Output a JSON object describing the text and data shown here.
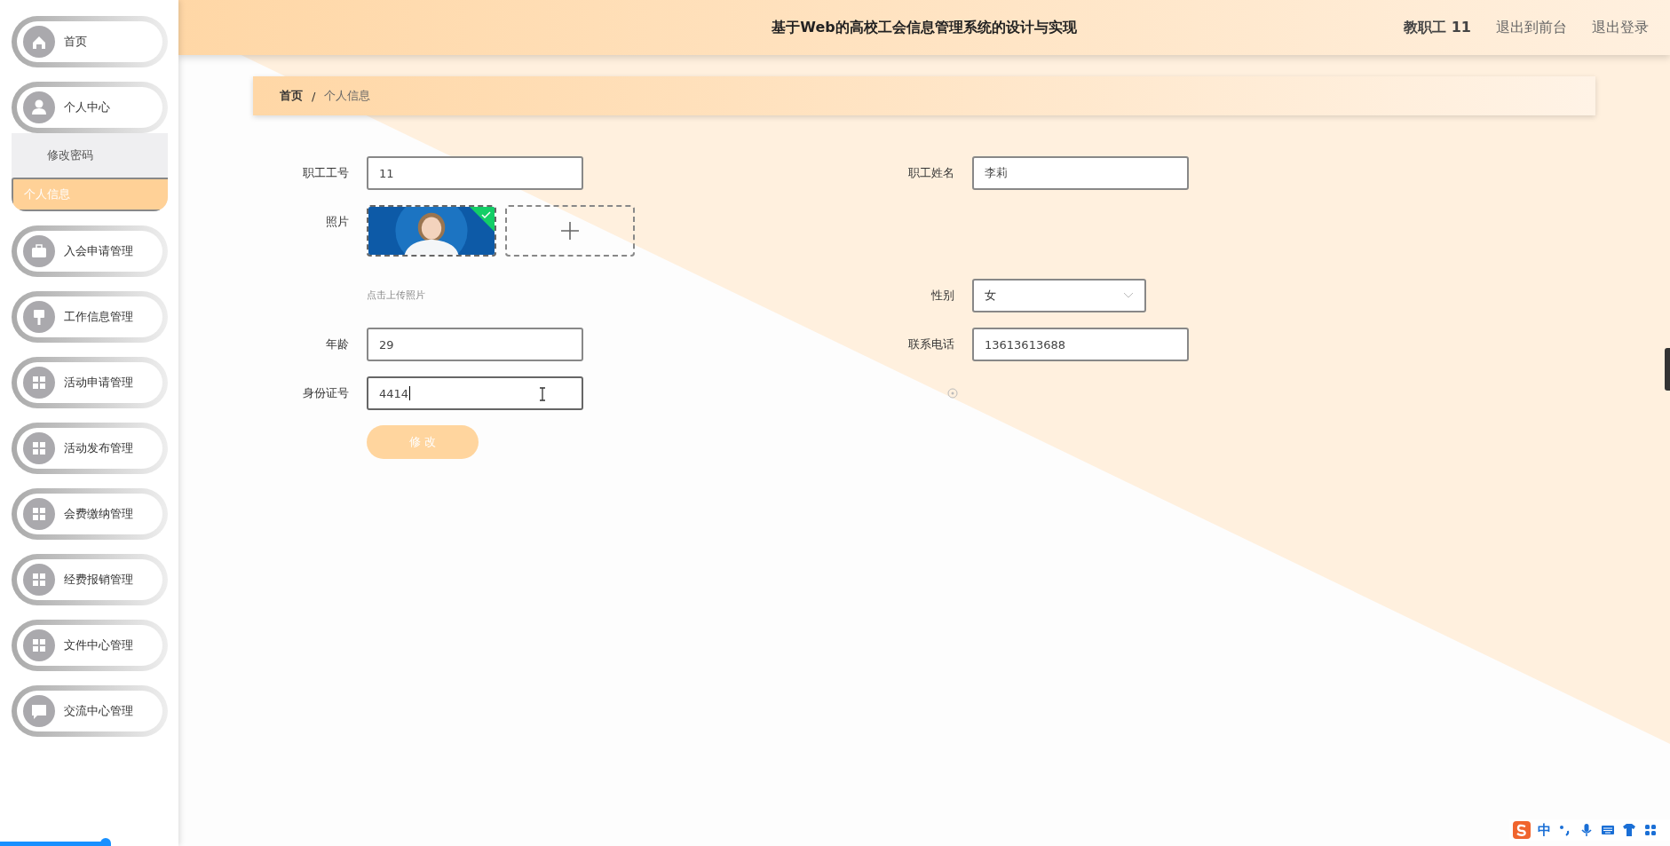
{
  "sidebar": {
    "items": [
      {
        "label": "首页",
        "selected": false
      },
      {
        "label": "个人中心",
        "selected": false,
        "expanded": true,
        "children": [
          {
            "label": "修改密码",
            "selected": false
          },
          {
            "label": "个人信息",
            "selected": true
          }
        ]
      },
      {
        "label": "入会申请管理",
        "selected": false
      },
      {
        "label": "工作信息管理",
        "selected": false
      },
      {
        "label": "活动申请管理",
        "selected": false
      },
      {
        "label": "活动发布管理",
        "selected": false
      },
      {
        "label": "会费缴纳管理",
        "selected": false
      },
      {
        "label": "经费报销管理",
        "selected": false
      },
      {
        "label": "文件中心管理",
        "selected": false
      },
      {
        "label": "交流中心管理",
        "selected": false
      }
    ]
  },
  "top_bar": {
    "title": "基于Web的高校工会信息管理系统的设计与实现",
    "user": "教职工 11",
    "links": [
      "退出到前台",
      "退出登录"
    ]
  },
  "breadcrumb": {
    "items": [
      "首页",
      "个人信息"
    ],
    "separator": "/"
  },
  "form": {
    "rows": [
      {
        "left": {
          "kind": "input",
          "label": "职工工号",
          "value": "11",
          "focused": false
        },
        "right": {
          "kind": "input",
          "label": "职工姓名",
          "value": "李莉",
          "focused": false
        }
      },
      {
        "left": {
          "kind": "upload",
          "label": "照片",
          "uploaded": true
        }
      },
      {
        "left": {
          "kind": "hint",
          "text": "点击上传照片"
        },
        "right": {
          "kind": "select",
          "label": "性别",
          "value": "女"
        }
      },
      {
        "left": {
          "kind": "input",
          "label": "年龄",
          "value": "29",
          "focused": false
        },
        "right": {
          "kind": "input",
          "label": "联系电话",
          "value": "13613613688",
          "focused": false
        }
      },
      {
        "left": {
          "kind": "input",
          "label": "身份证号",
          "value": "4414",
          "focused": true
        }
      }
    ],
    "submit": {
      "label": "修 改"
    }
  },
  "ime_toolbar": {
    "mode": "中"
  },
  "progress": {
    "level": 0.063
  }
}
